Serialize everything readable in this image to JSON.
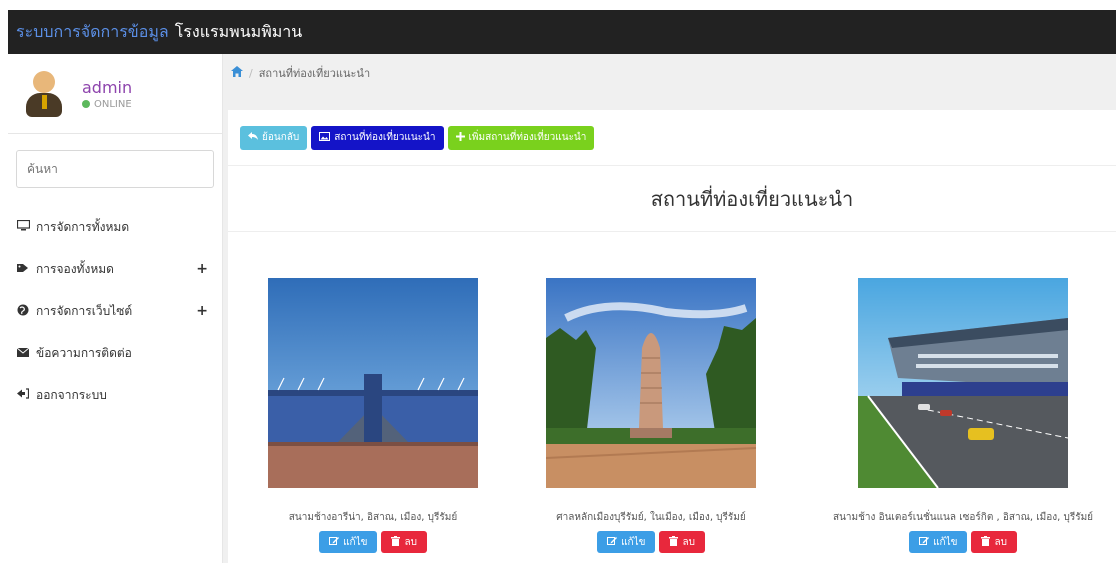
{
  "header": {
    "brand_accent": "ระบบการจัดการข้อมูล",
    "brand_name": "โรงแรมพนมพิมาน"
  },
  "sidebar": {
    "username": "admin",
    "status": "ONLINE",
    "search_placeholder": "ค้นหา",
    "items": [
      {
        "label": "การจัดการทั้งหมด",
        "icon": "monitor-icon",
        "expandable": false
      },
      {
        "label": "การจองทั้งหมด",
        "icon": "tag-icon",
        "expandable": true
      },
      {
        "label": "การจัดการเว็บไซต์",
        "icon": "globe-icon",
        "expandable": true
      },
      {
        "label": "ข้อความการติดต่อ",
        "icon": "envelope-icon",
        "expandable": false
      },
      {
        "label": "ออกจากระบบ",
        "icon": "sign-out-icon",
        "expandable": false
      }
    ],
    "plus_symbol": "+"
  },
  "breadcrumb": {
    "current": "สถานที่ท่องเที่ยวแนะนำ"
  },
  "toolbar": {
    "back_label": "ย้อนกลับ",
    "list_label": "สถานที่ท่องเที่ยวแนะนำ",
    "add_label": "เพิ่มสถานที่ท่องเที่ยวแนะนำ"
  },
  "page_title": "สถานที่ท่องเที่ยวแนะนำ",
  "cards": [
    {
      "caption": "สนามช้างอารีน่า, อิสาณ, เมือง, บุรีรัมย์",
      "edit_label": "แก้ไข",
      "delete_label": "ลบ"
    },
    {
      "caption": "ศาลหลักเมืองบุรีรัมย์, ในเมือง, เมือง, บุรีรัมย์",
      "edit_label": "แก้ไข",
      "delete_label": "ลบ"
    },
    {
      "caption": "สนามช้าง อินเตอร์เนชั่นแนล เซอร์กิต , อิสาณ, เมือง, บุรีรัมย์",
      "edit_label": "แก้ไข",
      "delete_label": "ลบ"
    }
  ],
  "colors": {
    "topbar": "#222222",
    "brand_accent": "#5b8fe6",
    "username": "#8e44ad",
    "online": "#5cb85c",
    "btn_info": "#5bc0de",
    "btn_blue": "#1414c8",
    "btn_green": "#7ad11d",
    "btn_edit": "#3c9ee6",
    "btn_delete": "#e8283c"
  }
}
